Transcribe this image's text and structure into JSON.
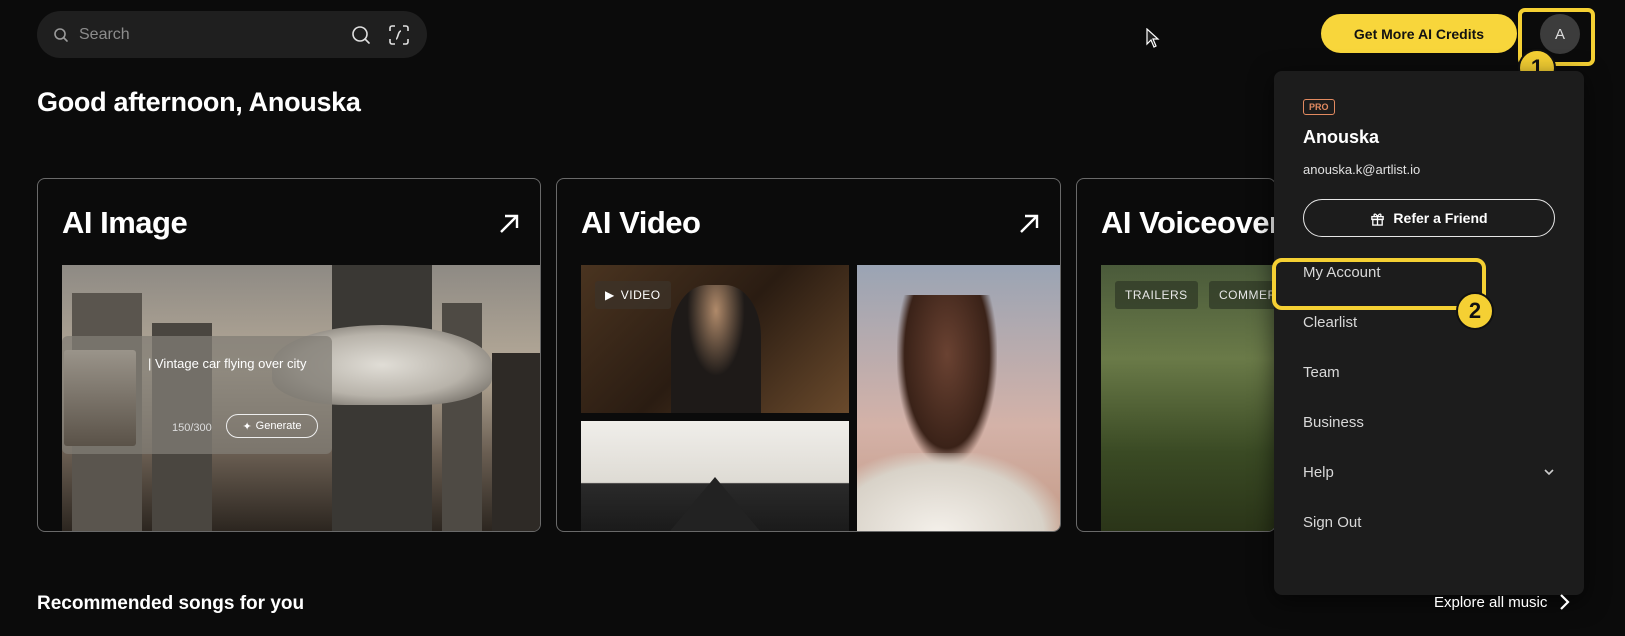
{
  "search": {
    "placeholder": "Search",
    "search_icon": "search-icon",
    "visual_search_icon": "visual-search-icon"
  },
  "header": {
    "credits_label": "Get More AI Credits",
    "avatar_initial": "A"
  },
  "annotations": {
    "step1": "1",
    "step2": "2",
    "highlight_color": "#f5d033"
  },
  "greeting": "Good afternoon, Anouska",
  "cards": {
    "ai_image": {
      "title": "AI Image",
      "prompt_text": "| Vintage car flying over city",
      "prompt_count": "150/300",
      "generate_label": "Generate"
    },
    "ai_video": {
      "title": "AI Video",
      "video_tag": "VIDEO"
    },
    "ai_voiceover": {
      "title": "AI Voiceover",
      "tags": [
        "TRAILERS",
        "COMMERCIALS"
      ]
    }
  },
  "menu": {
    "plan_badge": "PRO",
    "name": "Anouska",
    "email": "anouska.k@artlist.io",
    "refer_label": "Refer a Friend",
    "items": [
      "My Account",
      "Clearlist",
      "Team",
      "Business",
      "Help",
      "Sign Out"
    ]
  },
  "recommended": {
    "title": "Recommended songs for you",
    "explore_label": "Explore all music"
  },
  "colors": {
    "accent_yellow": "#f8d63b",
    "pro_badge": "#e28a60",
    "background": "#0b0b0b"
  }
}
